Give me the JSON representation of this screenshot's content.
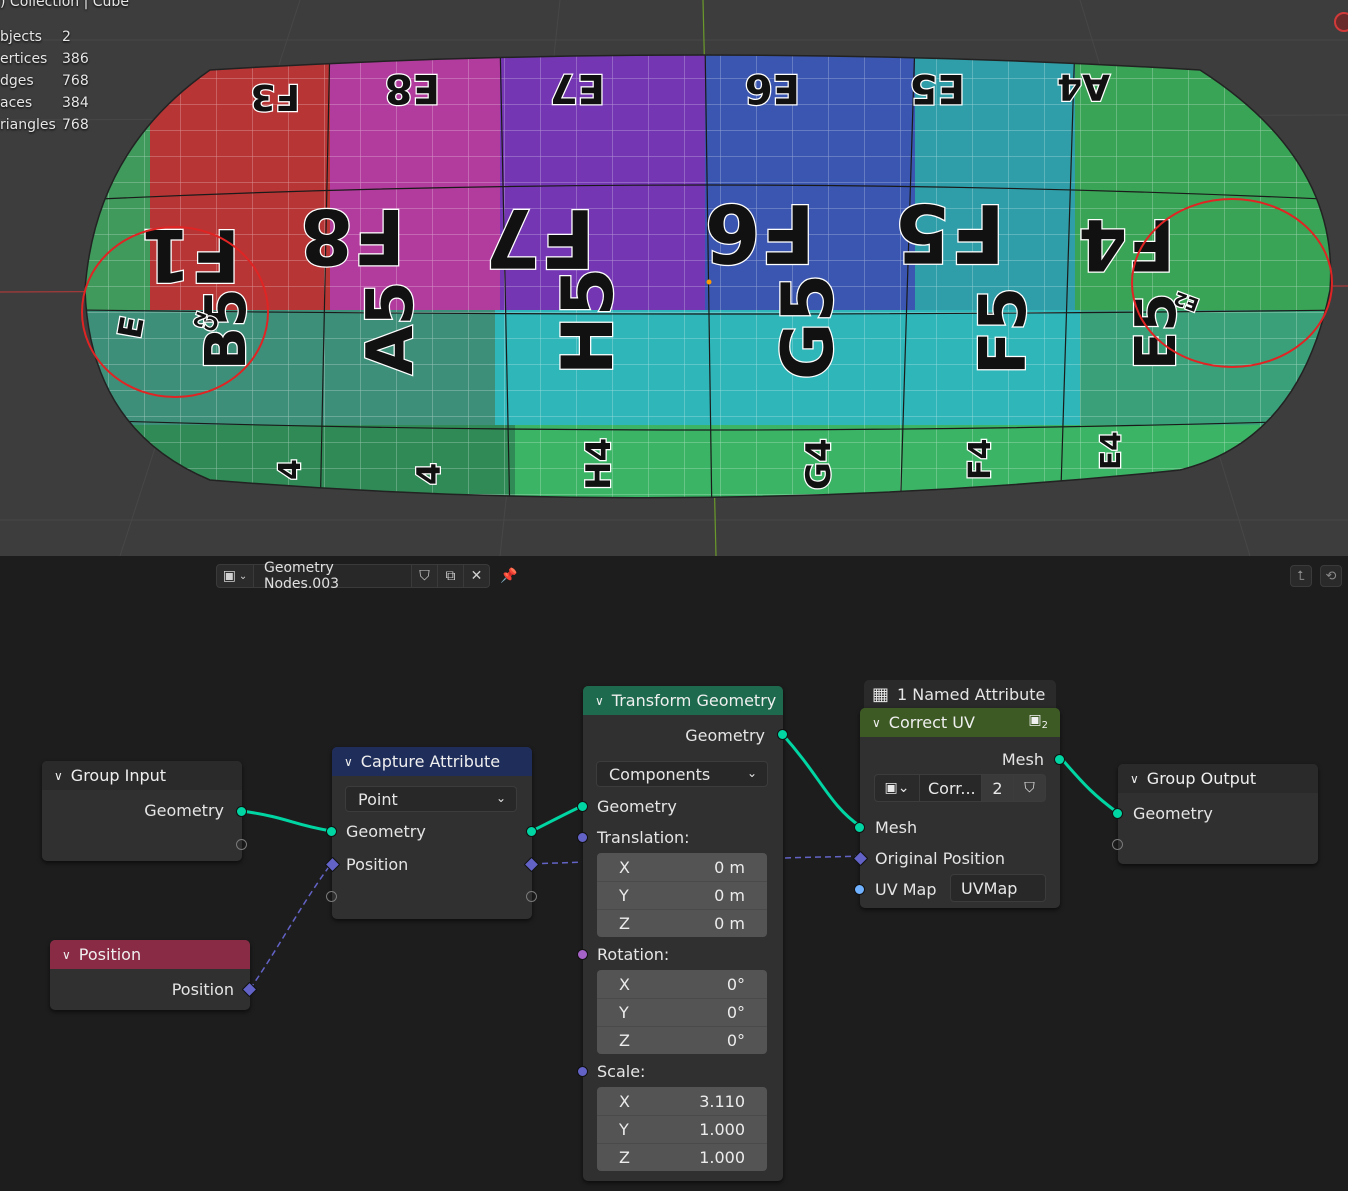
{
  "viewport": {
    "collection_label": ") Collection | Cube",
    "stats": [
      {
        "key": "bjects",
        "value": "2"
      },
      {
        "key": "ertices",
        "value": "386"
      },
      {
        "key": "dges",
        "value": "768"
      },
      {
        "key": "aces",
        "value": "384"
      },
      {
        "key": "riangles",
        "value": "768"
      }
    ],
    "uv_labels_top": [
      "F3",
      "E8",
      "E7",
      "E6",
      "E5",
      "A4"
    ],
    "uv_labels_mid": [
      "F1",
      "F8",
      "F7",
      "F6",
      "F5",
      "F4"
    ],
    "uv_labels_low": [
      "B5",
      "A5",
      "H5",
      "G5",
      "F5",
      "E5"
    ],
    "uv_labels_bottom": [
      "4",
      "4",
      "H4",
      "G4",
      "F4",
      "E4"
    ],
    "uv_small": [
      "E",
      "C2",
      "E2"
    ],
    "colors": {
      "red_annotation": "#e02424",
      "axis_x": "#c03a3a",
      "axis_y": "#7aa130"
    }
  },
  "editor": {
    "tree_name": "Geometry Nodes.003",
    "group_input": {
      "title": "Group Input",
      "geometry": "Geometry"
    },
    "position_node": {
      "title": "Position",
      "output": "Position"
    },
    "capture": {
      "title": "Capture Attribute",
      "domain": "Point",
      "geometry": "Geometry",
      "position": "Position"
    },
    "transform": {
      "title": "Transform Geometry",
      "out_geometry": "Geometry",
      "mode": "Components",
      "in_geometry": "Geometry",
      "translation_label": "Translation:",
      "translation": [
        {
          "axis": "X",
          "value": "0 m"
        },
        {
          "axis": "Y",
          "value": "0 m"
        },
        {
          "axis": "Z",
          "value": "0 m"
        }
      ],
      "rotation_label": "Rotation:",
      "rotation": [
        {
          "axis": "X",
          "value": "0°"
        },
        {
          "axis": "Y",
          "value": "0°"
        },
        {
          "axis": "Z",
          "value": "0°"
        }
      ],
      "scale_label": "Scale:",
      "scale": [
        {
          "axis": "X",
          "value": "3.110"
        },
        {
          "axis": "Y",
          "value": "1.000"
        },
        {
          "axis": "Z",
          "value": "1.000"
        }
      ]
    },
    "correct_uv": {
      "badge": "1 Named Attribute",
      "title": "Correct UV",
      "badge_count": "2",
      "out_mesh": "Mesh",
      "group_name": "Corr...",
      "user_count": "2",
      "in_mesh": "Mesh",
      "original_position": "Original Position",
      "uv_map_label": "UV Map",
      "uv_map_value": "UVMap"
    },
    "group_output": {
      "title": "Group Output",
      "geometry": "Geometry"
    },
    "colors": {
      "geometry_socket": "#00d6a3",
      "vector_socket": "#6363c7",
      "capture_header": "#1f2d5a",
      "transform_header": "#1d6a4e",
      "correct_uv_header": "#3d5a25",
      "position_header": "#8a2b45"
    }
  }
}
